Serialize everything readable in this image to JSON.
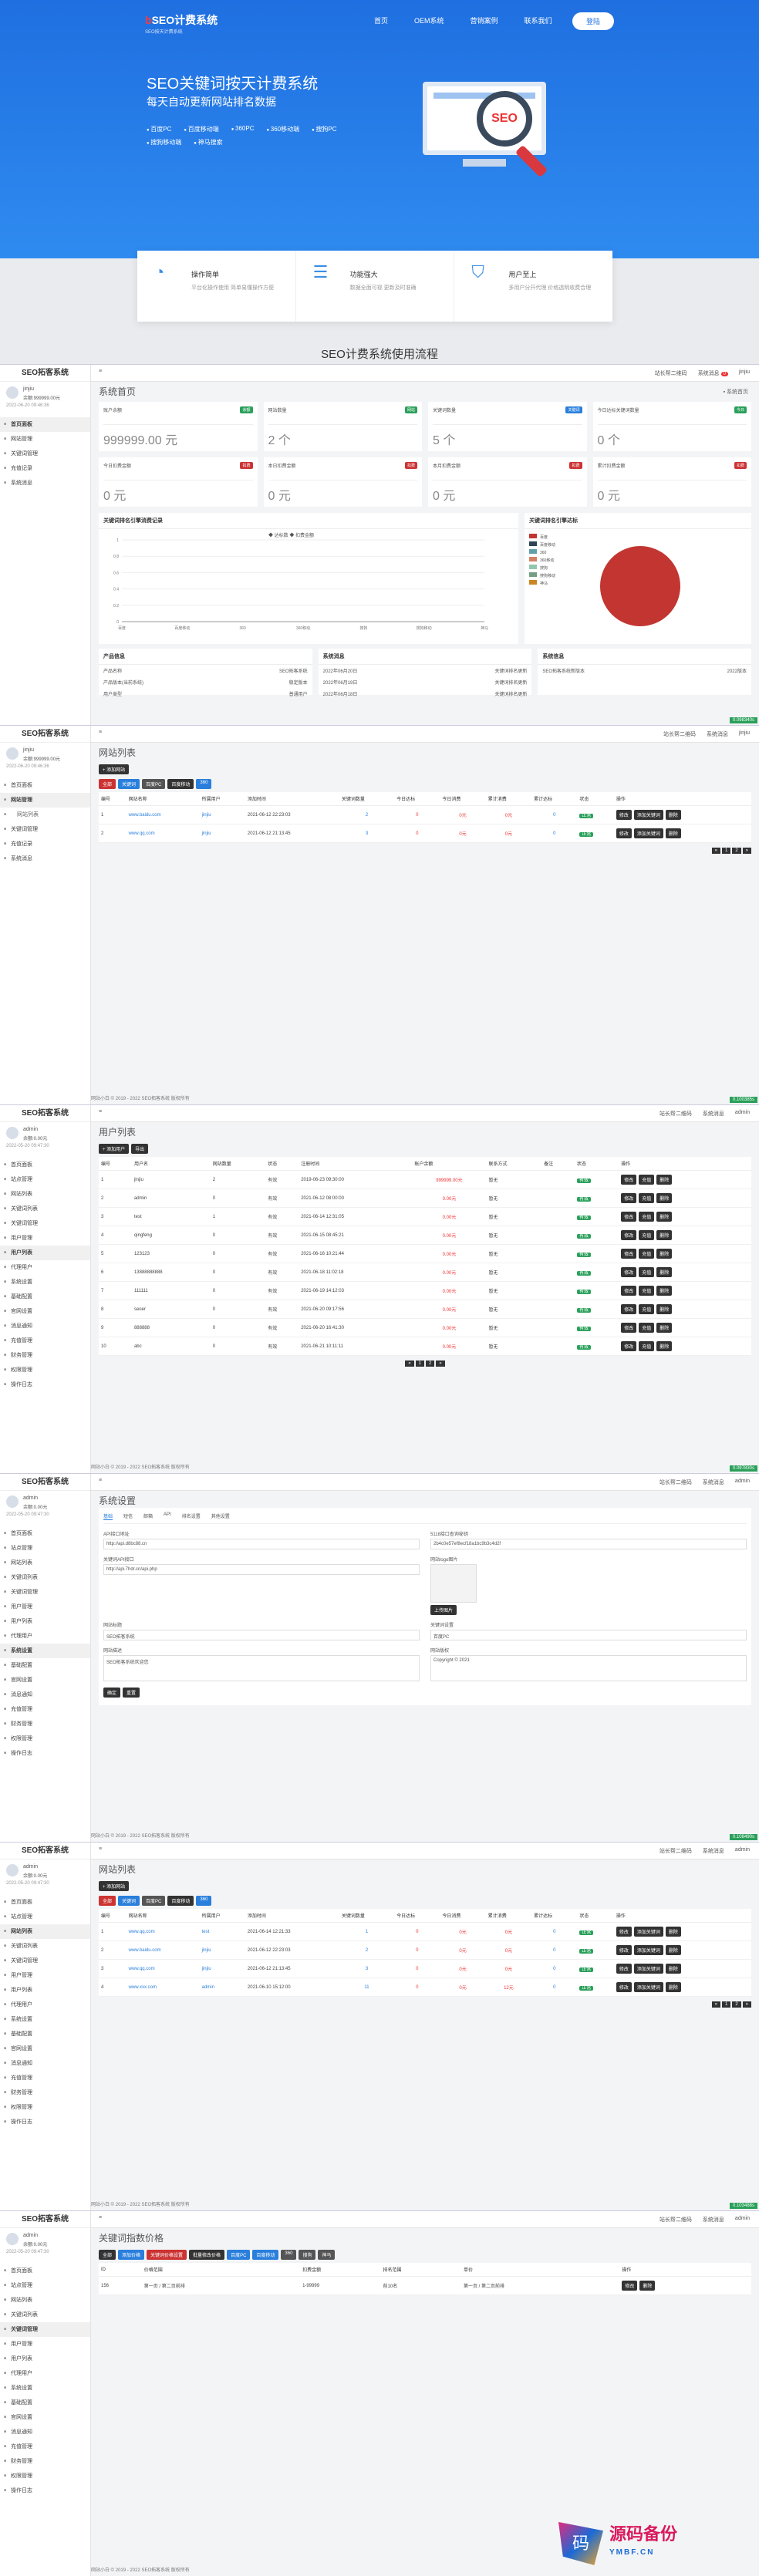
{
  "hero": {
    "logo": "b",
    "logo_name": "SEO计费系统",
    "logo_sub": "SEO按天计费系统",
    "nav": [
      "首页",
      "OEM系统",
      "营销案例",
      "联系我们"
    ],
    "nav_btn": "登陆",
    "title": "SEO关键词按天计费系统",
    "subtitle": "每天自动更新网站排名数据",
    "features": [
      "百度PC",
      "百度移动端",
      "360PC",
      "360移动端",
      "搜狗PC",
      "搜狗移动端",
      "神马搜索"
    ],
    "monitor_text": "SEO"
  },
  "cards": [
    {
      "title": "操作简单",
      "desc": "平台化操作使用 简单易懂操作方便"
    },
    {
      "title": "功能强大",
      "desc": "数据全面可视 更新及时准确"
    },
    {
      "title": "用户至上",
      "desc": "多用户分开代理 价格透明收费合理"
    }
  ],
  "flow_title": "SEO计费系统使用流程",
  "sys_title": "SEO拓客系统",
  "user1": {
    "name": "jinjiu",
    "balance": "余额:999999.00元",
    "date": "2022-06-20 09:46:36"
  },
  "user2": {
    "name": "admin",
    "balance": "余额:0.00元",
    "date": "2022-05-20 09:47:30"
  },
  "menu_user": [
    "首页面板",
    "网站管理",
    "关键词管理",
    "充值记录",
    "系统消息"
  ],
  "menu_admin": [
    "首页面板",
    "站点管理",
    "网站列表",
    "关键词列表",
    "关键词管理",
    "用户管理",
    "用户列表",
    "代理用户",
    "系统设置",
    "基础配置",
    "官网设置",
    "消息通知",
    "充值管理",
    "财务管理",
    "权限管理",
    "操作日志"
  ],
  "topbar": {
    "menu": "≡",
    "notice": "站长帮二维码",
    "msgs": "系统消息",
    "msgs_count": "0",
    "admin": "admin",
    "jinjiu": "jinjiu"
  },
  "dashboard": {
    "title": "系统首页",
    "breadcrumb": "▪ 系统首页",
    "stats": [
      {
        "label": "账户余额",
        "tag": "余额",
        "value": "999999.00 元",
        "color": "#2aa05a"
      },
      {
        "label": "网站数量",
        "tag": "网站",
        "value": "2 个",
        "color": "#2aa05a"
      },
      {
        "label": "关键词数量",
        "tag": "关键词",
        "value": "5 个",
        "color": "#2a7fdc"
      },
      {
        "label": "今日达标关键词数量",
        "tag": "今日",
        "value": "0 个",
        "color": "#2aa05a"
      },
      {
        "label": "今日扣费金额",
        "tag": "扣费",
        "value": "0 元",
        "color": "#c33"
      },
      {
        "label": "本日扣费金额",
        "tag": "扣费",
        "value": "0 元",
        "color": "#c33"
      },
      {
        "label": "本月扣费金额",
        "tag": "扣费",
        "value": "0 元",
        "color": "#c33"
      },
      {
        "label": "累计扣费金额",
        "tag": "扣费",
        "value": "0 元",
        "color": "#c33"
      }
    ],
    "line_title": "关键词排名引擎消费记录",
    "line_legend": [
      "达标数",
      "扣费金额"
    ],
    "pie_title": "关键词排名引擎达标",
    "pie_legend": [
      "百度",
      "百度移动",
      "360",
      "360移动",
      "搜狗",
      "搜狗移动",
      "神马"
    ],
    "panels": [
      {
        "title": "产品信息",
        "rows": [
          [
            "产品名称",
            "SEO拓客系统"
          ],
          [
            "产品版本(当前系统)",
            "稳定版本"
          ],
          [
            "用户类型",
            "普通用户"
          ]
        ]
      },
      {
        "title": "系统消息",
        "rows": [
          [
            "2022年06月20日",
            "关键词排名更新"
          ],
          [
            "2022年06月19日",
            "关键词排名更新"
          ],
          [
            "2022年06月18日",
            "关键词排名更新"
          ]
        ]
      },
      {
        "title": "系统信息",
        "rows": [
          [
            "SEO拓客系统新版本",
            "2022版本"
          ]
        ]
      }
    ]
  },
  "chart_data": {
    "type": "line",
    "title": "关键词排名引擎消费记录",
    "categories": [
      "百度",
      "百度移动",
      "360",
      "360移动",
      "搜狗",
      "搜狗移动",
      "神马"
    ],
    "series": [
      {
        "name": "达标数",
        "values": [
          0,
          0,
          0,
          0,
          0,
          0,
          0
        ]
      },
      {
        "name": "扣费金额",
        "values": [
          0,
          0,
          0,
          0,
          0,
          0,
          0
        ]
      }
    ],
    "yticks": [
      "0",
      "0.2",
      "0.4",
      "0.6",
      "0.8",
      "1"
    ],
    "ylim": [
      0,
      1
    ]
  },
  "site_list": {
    "title": "网站列表",
    "add_btn": "+ 添加网站",
    "filters": [
      "全部",
      "关键词",
      "百度PC",
      "百度移动",
      "360"
    ],
    "columns": [
      "编号",
      "网站名称",
      "所属用户",
      "添加时间",
      "关键词数量",
      "今日达标",
      "今日消费",
      "累计消费",
      "累计达标",
      "状态",
      "操作"
    ],
    "rows": [
      [
        "1",
        "www.baidu.com",
        "jinjiu",
        "2021-06-12 22:23:03",
        "2",
        "0",
        "0元",
        "0元",
        "0",
        "正常"
      ],
      [
        "2",
        "www.qq.com",
        "jinjiu",
        "2021-06-12 21:13:45",
        "3",
        "0",
        "0元",
        "0元",
        "0",
        "正常"
      ]
    ],
    "ops": [
      "修改",
      "添加关键词",
      "删除"
    ],
    "pager": [
      "«",
      "1",
      "2",
      "»"
    ]
  },
  "user_list": {
    "title": "用户列表",
    "add_btn": "+ 添加用户",
    "extra_btn": "导出",
    "columns": [
      "编号",
      "用户名",
      "网站数量",
      "状态",
      "注册时间",
      "账户余额",
      "联系方式",
      "备注",
      "状态",
      "操作"
    ],
    "rows": [
      [
        "1",
        "jinjiu",
        "2",
        "有效",
        "2019-06-23 09:30:00",
        "999999.00元",
        "暂无"
      ],
      [
        "2",
        "admin",
        "0",
        "有效",
        "2021-06-12 08:00:00",
        "0.00元",
        "暂无"
      ],
      [
        "3",
        "test",
        "1",
        "有效",
        "2021-06-14 12:31:05",
        "0.00元",
        "暂无"
      ],
      [
        "4",
        "qingfeng",
        "0",
        "有效",
        "2021-06-15 08:45:21",
        "0.00元",
        "暂无"
      ],
      [
        "5",
        "123123",
        "0",
        "有效",
        "2021-06-16 10:21:44",
        "0.00元",
        "暂无"
      ],
      [
        "6",
        "13888888888",
        "0",
        "有效",
        "2021-06-18 11:02:18",
        "0.00元",
        "暂无"
      ],
      [
        "7",
        "111111",
        "0",
        "有效",
        "2021-06-19 14:12:03",
        "0.00元",
        "暂无"
      ],
      [
        "8",
        "seoer",
        "0",
        "有效",
        "2021-06-20 09:17:56",
        "0.00元",
        "暂无"
      ],
      [
        "9",
        "888888",
        "0",
        "有效",
        "2021-06-20 16:41:30",
        "0.00元",
        "暂无"
      ],
      [
        "10",
        "abc",
        "0",
        "有效",
        "2021-06-21 10:11:11",
        "0.00元",
        "暂无"
      ]
    ],
    "ops": [
      "修改",
      "充值",
      "删除"
    ],
    "pager": [
      "«",
      "1",
      "2",
      "»"
    ]
  },
  "settings": {
    "title": "系统设置",
    "tabs": [
      "基础",
      "短信",
      "邮箱",
      "API",
      "排名设置",
      "其他设置"
    ],
    "fields": [
      {
        "label": "API接口地址",
        "value": "http://api.d8bc88.cn"
      },
      {
        "label": "5118接口查询秘钥",
        "value": "2b4c0e57ef8ecf18a1bc9b3c4d2f"
      },
      {
        "label": "关键词API接口",
        "value": "http://api.7hdr.cn/api.php"
      },
      {
        "label": "网站logo图片",
        "value": "上传图片"
      },
      {
        "label": "网站标题",
        "value": "SEO拓客系统"
      },
      {
        "label": "关键词设置",
        "value": "百度PC"
      },
      {
        "label": "网站描述",
        "value": "SEO拓客系统欢迎您"
      },
      {
        "label": "网站版权",
        "value": "Copyright © 2021"
      }
    ],
    "save": "确定",
    "reset": "重置"
  },
  "site_list2": {
    "rows": [
      [
        "1",
        "www.qq.com",
        "test",
        "2021-06-14 12:21:33",
        "1",
        "0",
        "0元",
        "0元",
        "0",
        "正常"
      ],
      [
        "2",
        "www.baidu.com",
        "jinjiu",
        "2021-06-12 22:23:03",
        "2",
        "0",
        "0元",
        "0元",
        "0",
        "正常"
      ],
      [
        "3",
        "www.qq.com",
        "jinjiu",
        "2021-06-12 21:13:45",
        "3",
        "0",
        "0元",
        "0元",
        "0",
        "正常"
      ],
      [
        "4",
        "www.xxx.com",
        "admin",
        "2021-06-10 15:12:00",
        "11",
        "0",
        "0元",
        "12元",
        "0",
        "正常"
      ]
    ]
  },
  "price": {
    "title": "关键词指数价格",
    "filters": [
      "全部",
      "添加价格",
      "关键词价格设置",
      "批量修改价格",
      "百度PC",
      "百度移动",
      "360",
      "搜狗",
      "神马"
    ],
    "columns": [
      "ID",
      "价格范围",
      "扣费金额",
      "排名范围",
      "单价",
      "操作"
    ],
    "rows": [
      [
        "156",
        "第一页 / 第二页前排",
        "1-99999",
        "前10名",
        "第一页 / 第二页前排",
        ""
      ]
    ],
    "ops": [
      "修改",
      "删除"
    ]
  },
  "footer": "网站小白 © 2019 - 2022 SEO拓客系统 版权所有",
  "version_tags": [
    "0.041266s",
    "0.098340s",
    "0.100385s",
    "0.097830s",
    "0.108490s",
    "0.103488s",
    "0.107440s"
  ],
  "watermark": {
    "text": "源码备份",
    "sub": "YMBF.CN",
    "glyph": "码"
  }
}
